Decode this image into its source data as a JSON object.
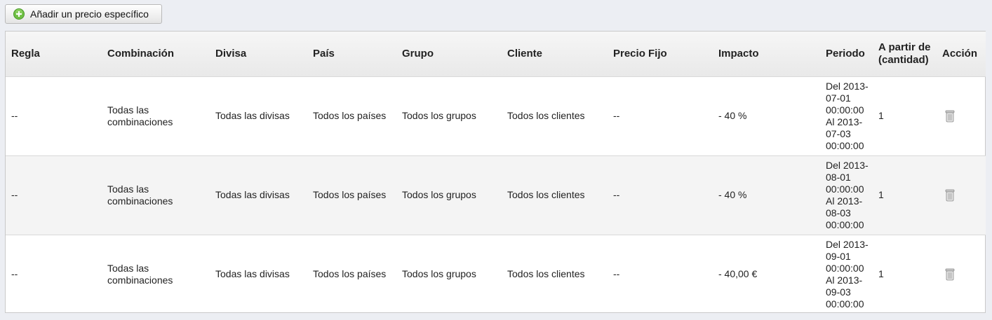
{
  "toolbar": {
    "add_label": "Añadir un precio específico",
    "add_icon": "plus-circle-icon"
  },
  "table": {
    "headers": [
      "Regla",
      "Combinación",
      "Divisa",
      "País",
      "Grupo",
      "Cliente",
      "Precio Fijo",
      "Impacto",
      "Periodo",
      "A partir de (cantidad)",
      "Acción"
    ],
    "rows": [
      {
        "regla": "--",
        "combinacion": "Todas las combinaciones",
        "divisa": "Todas las divisas",
        "pais": "Todos los países",
        "grupo": "Todos los grupos",
        "cliente": "Todos los clientes",
        "precio_fijo": "--",
        "impacto": "- 40 %",
        "periodo": "Del 2013-07-01 00:00:00 Al 2013-07-03 00:00:00",
        "cantidad": "1",
        "action_icon": "trash-icon"
      },
      {
        "regla": "--",
        "combinacion": "Todas las combinaciones",
        "divisa": "Todas las divisas",
        "pais": "Todos los países",
        "grupo": "Todos los grupos",
        "cliente": "Todos los clientes",
        "precio_fijo": "--",
        "impacto": "- 40 %",
        "periodo": "Del 2013-08-01 00:00:00 Al 2013-08-03 00:00:00",
        "cantidad": "1",
        "action_icon": "trash-icon"
      },
      {
        "regla": "--",
        "combinacion": "Todas las combinaciones",
        "divisa": "Todas las divisas",
        "pais": "Todos los países",
        "grupo": "Todos los grupos",
        "cliente": "Todos los clientes",
        "precio_fijo": "--",
        "impacto": "- 40,00 €",
        "periodo": "Del 2013-09-01 00:00:00 Al 2013-09-03 00:00:00",
        "cantidad": "1",
        "action_icon": "trash-icon"
      }
    ]
  },
  "colors": {
    "background": "#eceef3",
    "header_bg": "#efefef",
    "alt_row": "#f4f4f4",
    "add_icon_green": "#5cb432"
  }
}
